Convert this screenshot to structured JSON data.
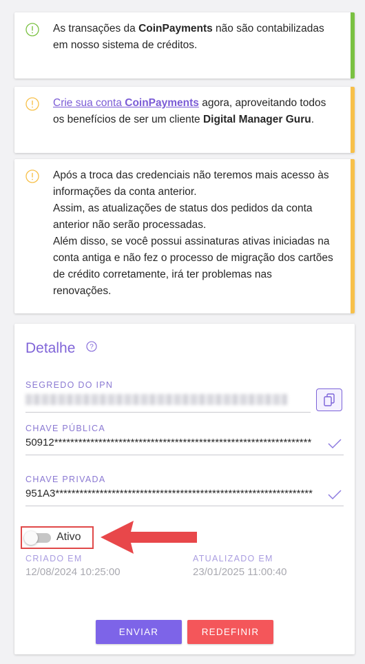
{
  "alerts": [
    {
      "type": "success",
      "color": "#7ac142",
      "line1_pre": "As transações da ",
      "line1_bold": "CoinPayments",
      "line1_post": " não são contabilizadas",
      "line2": "em nosso sistema de créditos."
    },
    {
      "type": "warning",
      "color": "#f7c04a",
      "link_pre": "Crie sua conta ",
      "link_bold": "CoinPayments",
      "after_link": " agora, aproveitando todos",
      "line2_pre": "os benefícios de ser um cliente ",
      "line2_bold": "Digital Manager Guru",
      "line2_post": "."
    },
    {
      "type": "warning",
      "color": "#f7c04a",
      "lines": [
        "Após a troca das credenciais não teremos mais acesso às",
        "informações da conta anterior.",
        "Assim, as atualizações de status dos pedidos da conta",
        "anterior não serão processadas.",
        "Além disso, se você possui assinaturas ativas iniciadas na",
        "conta antiga e não fez o processo de migração dos cartões",
        "de crédito corretamente, irá ter problemas nas",
        "renovações."
      ]
    }
  ],
  "detail": {
    "title": "Detalhe",
    "ipn_label": "SEGREDO DO IPN",
    "public_key_label": "CHAVE PÚBLICA",
    "public_key_value": "50912****************************************************************",
    "private_key_label": "CHAVE PRIVADA",
    "private_key_value": "951A3****************************************************************",
    "toggle_label": "Ativo",
    "toggle_on": false,
    "created_label": "CRIADO EM",
    "created_value": "12/08/2024 10:25:00",
    "updated_label": "ATUALIZADO EM",
    "updated_value": "23/01/2025 11:00:40",
    "send_label": "ENVIAR",
    "reset_label": "REDEFINIR"
  },
  "colors": {
    "accent": "#7d64e8",
    "danger": "#f4565a",
    "success": "#7ac142",
    "warning": "#f7c04a",
    "highlight": "#e04848"
  }
}
